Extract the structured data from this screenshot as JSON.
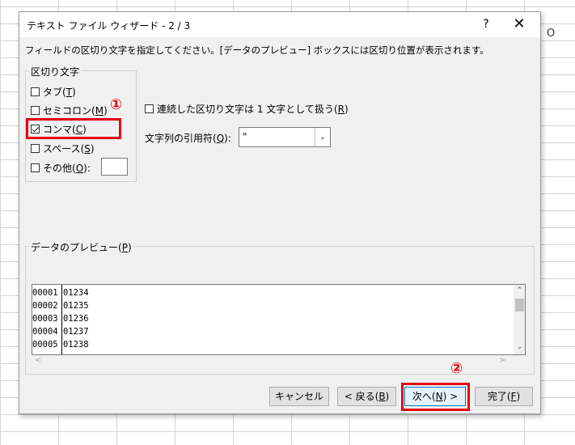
{
  "spreadsheet": {
    "column_label": "O"
  },
  "dialog": {
    "title": "テキスト ファイル ウィザード - 2 / 3",
    "help_label": "?",
    "close_label": "✕",
    "instruction": "フィールドの区切り文字を指定してください。[データのプレビュー] ボックスには区切り位置が表示されます。"
  },
  "delimiters": {
    "label": "区切り文字",
    "items": [
      {
        "text": "タブ",
        "key": "T",
        "checked": false
      },
      {
        "text": "セミコロン",
        "key": "M",
        "checked": false
      },
      {
        "text": "コンマ",
        "key": "C",
        "checked": true
      },
      {
        "text": "スペース",
        "key": "S",
        "checked": false
      },
      {
        "text": "その他",
        "key": "O",
        "checked": false
      }
    ],
    "other_value": ""
  },
  "consecutive": {
    "text": "連続した区切り文字は 1 文字として扱う",
    "key": "R",
    "checked": false
  },
  "qualifier": {
    "text": "文字列の引用符",
    "key": "Q",
    "value": "\""
  },
  "preview": {
    "label": "データのプレビュー",
    "key": "P",
    "rows": [
      [
        "00001",
        "01234"
      ],
      [
        "00002",
        "01235"
      ],
      [
        "00003",
        "01236"
      ],
      [
        "00004",
        "01237"
      ],
      [
        "00005",
        "01238"
      ]
    ]
  },
  "buttons": {
    "cancel": "キャンセル",
    "back": {
      "text": "< 戻る",
      "key": "B"
    },
    "next": {
      "text": "次へ",
      "key": "N",
      "suffix": " >"
    },
    "finish": {
      "text": "完了",
      "key": "F"
    }
  },
  "annotations": {
    "step1": "①",
    "step2": "②",
    "color": "#e60012"
  }
}
